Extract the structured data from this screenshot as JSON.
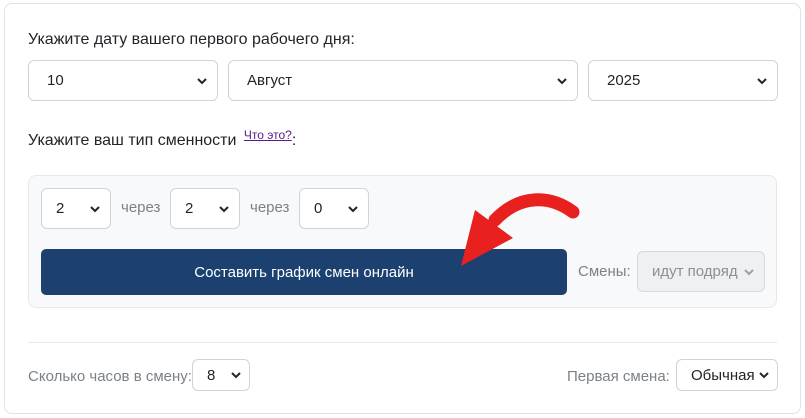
{
  "start_date": {
    "prompt": "Укажите дату вашего первого рабочего дня:",
    "day": "10",
    "month": "Август",
    "year": "2025"
  },
  "shift_type": {
    "prompt": "Укажите ваш тип сменности",
    "help_link": "Что это?",
    "colon": ":",
    "work_days": "2",
    "separator_1": "через",
    "off_days": "2",
    "separator_2": "через",
    "third_value": "0",
    "build_button": "Составить график смен онлайн",
    "shifts_label": "Смены:",
    "shifts_value": "идут подряд"
  },
  "footer": {
    "hours_label": "Сколько часов в смену:",
    "hours_value": "8",
    "first_shift_label": "Первая смена:",
    "first_shift_value": "Обычная"
  },
  "colors": {
    "button": "#1c4170",
    "arrow": "#e8201e",
    "panel": "#f8f9fa"
  },
  "icons": [
    "chevron-down-icon",
    "red-arrow-icon"
  ]
}
